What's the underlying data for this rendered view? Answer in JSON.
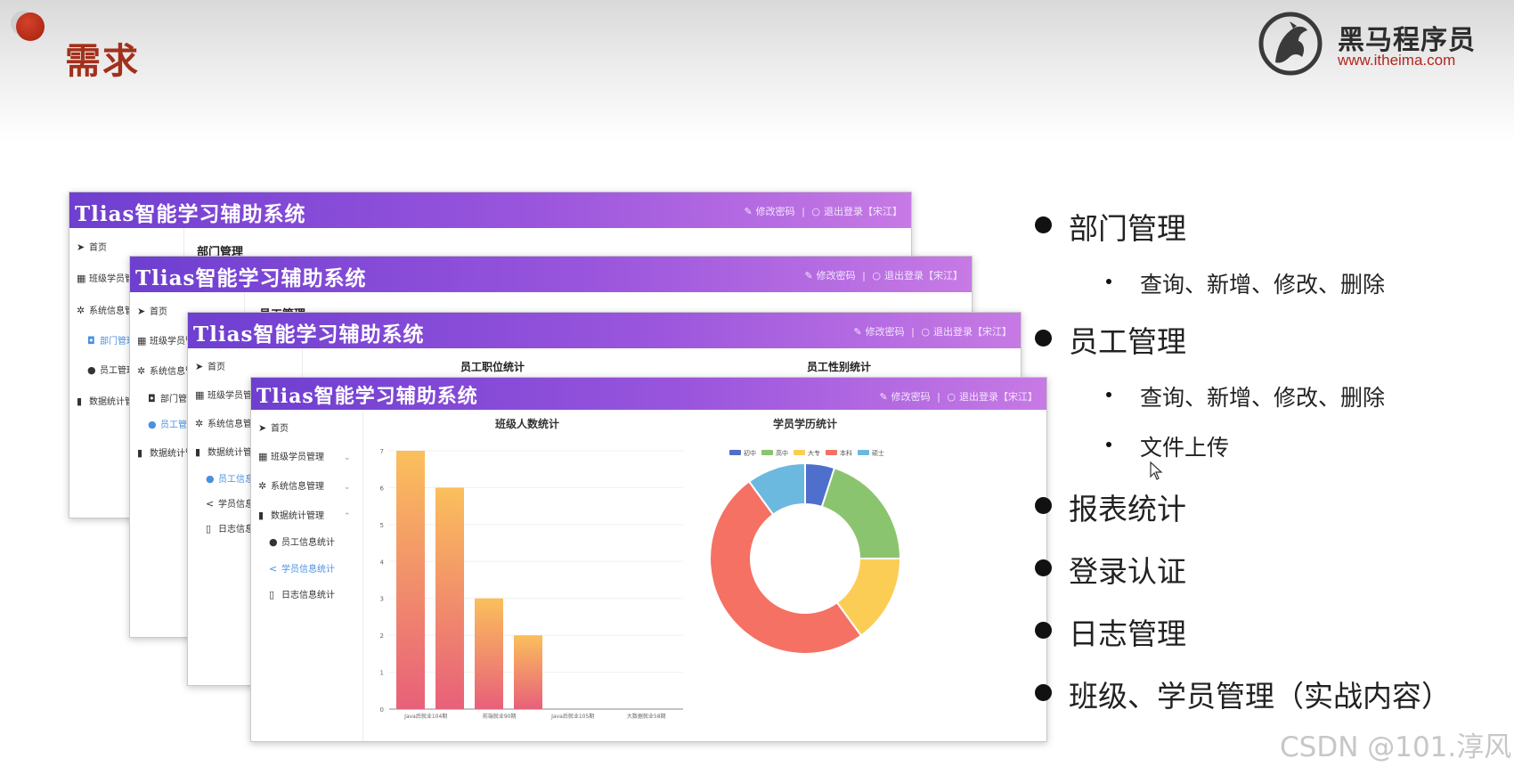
{
  "slide": {
    "title": "需求",
    "brand_name": "黑马程序员",
    "brand_url": "www.itheima.com",
    "watermark": "CSDN @101.淳风"
  },
  "app": {
    "title": "Tlias智能学习辅助系统",
    "action_change_password": "修改密码",
    "action_separator": "|",
    "action_logout": "退出登录【宋江】",
    "menu_home": "首页",
    "menu_class_student": "班级学员管理",
    "menu_system_info": "系统信息管理",
    "menu_dept": "部门管理",
    "menu_emp": "员工管理",
    "menu_report": "数据统计管理",
    "menu_emp_stats": "员工信息统计",
    "menu_student_stats": "学员信息统计",
    "menu_log_stats": "日志信息统计"
  },
  "windows": {
    "dept_page_title": "部门管理",
    "emp_page_title": "员工管理",
    "emp_position_title": "员工职位统计",
    "emp_gender_title": "员工性别统计"
  },
  "chart_data": [
    {
      "type": "bar",
      "title": "班级人数统计",
      "categories": [
        "Java后就业104期",
        "前端就业90期",
        "Java后就业105期",
        "大数据就业58期"
      ],
      "values": [
        7,
        6,
        3,
        2
      ],
      "ylim": [
        0,
        7
      ],
      "yticks": [
        "0",
        "1",
        "2",
        "3",
        "4",
        "5",
        "6",
        "7"
      ],
      "colors": [
        "#fbbf5c",
        "#e8607a"
      ],
      "grid": true
    },
    {
      "type": "pie",
      "title": "学员学历统计",
      "legend_position": "top",
      "slices": [
        {
          "name": "初中",
          "value": 1,
          "color": "#4f6fcc"
        },
        {
          "name": "高中",
          "value": 4,
          "color": "#8bc46e"
        },
        {
          "name": "大专",
          "value": 3,
          "color": "#fccd55"
        },
        {
          "name": "本科",
          "value": 10,
          "color": "#f47163"
        },
        {
          "name": "硕士",
          "value": 2,
          "color": "#6cb9e0"
        }
      ]
    }
  ],
  "bullets": [
    {
      "text": "部门管理",
      "sub": [
        "查询、新增、修改、删除"
      ]
    },
    {
      "text": "员工管理",
      "sub": [
        "查询、新增、修改、删除",
        "文件上传"
      ]
    },
    {
      "text": "报表统计",
      "sub": []
    },
    {
      "text": "登录认证",
      "sub": []
    },
    {
      "text": "日志管理",
      "sub": []
    },
    {
      "text": "班级、学员管理（实战内容）",
      "sub": []
    }
  ]
}
